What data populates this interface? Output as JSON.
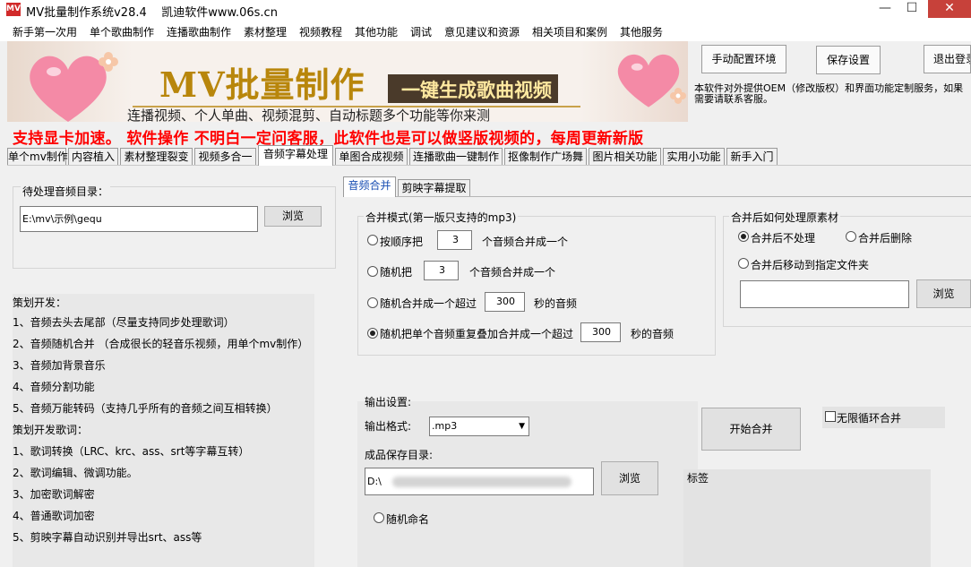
{
  "titlebar": {
    "title": "MV批量制作系统v28.4    凯迪软件www.06s.cn",
    "icon": "mv-app-icon",
    "icon_text": "MV",
    "minimize": "—",
    "maximize": "☐",
    "close": "✕"
  },
  "menu": [
    "新手第一次用",
    "单个歌曲制作",
    "连播歌曲制作",
    "素材整理",
    "视频教程",
    "其他功能",
    "调试",
    "意见建议和资源",
    "相关项目和案例",
    "其他服务"
  ],
  "banner": {
    "title": "MV批量制作",
    "slogan": "一键生成歌曲视频",
    "subtitle": "连播视频、个人单曲、视频混剪、自动标题多个功能等你来测"
  },
  "top_buttons": {
    "configure": "手动配置环境",
    "save": "保存设置",
    "exit": "退出登录"
  },
  "service_text": "本软件对外提供OEM（修改版权）和界面功能定制服务，如果需要请联系客服。",
  "notice": "支持显卡加速。  软件操作  不明白一定问客服，此软件也是可以做竖版视频的，每周更新新版",
  "main_tabs": [
    "单个mv制作",
    "内容植入",
    "素材整理裂变",
    "视频多合一",
    "音频字幕处理",
    "单图合成视频",
    "连播歌曲一键制作",
    "抠像制作广场舞",
    "图片相关功能",
    "实用小功能",
    "新手入门"
  ],
  "main_tab_active": 4,
  "left": {
    "dir_label": "待处理音频目录：",
    "dir_value": "E:\\mv\\示例\\gequ",
    "browse": "浏览",
    "notes": [
      "策划开发：",
      "1、音频去头去尾部（尽量支持同步处理歌词）",
      "2、音频随机合并 （合成很长的轻音乐视频，用单个mv制作）",
      "3、音频加背景音乐",
      "4、音频分割功能",
      "5、音频万能转码（支持几乎所有的音频之间互相转换）",
      "策划开发歌词：",
      "1、歌词转换（LRC、krc、ass、srt等字幕互转）",
      "2、歌词编辑、微调功能。",
      "3、加密歌词解密",
      "4、普通歌词加密",
      "5、剪映字幕自动识别并导出srt、ass等"
    ]
  },
  "sub_tabs": [
    "音频合并",
    "剪映字幕提取"
  ],
  "sub_tab_active": 0,
  "merge_mode": {
    "title": "合并模式(第一版只支持的mp3)",
    "options": [
      {
        "before": "按顺序把",
        "value": "3",
        "after": "个音频合并成一个",
        "selected": false
      },
      {
        "before": "随机把",
        "value": "3",
        "after": "个音频合并成一个",
        "selected": false
      },
      {
        "before": "随机合并成一个超过",
        "value": "300",
        "after": "秒的音频",
        "selected": false
      },
      {
        "before": "随机把单个音频重复叠加合并成一个超过",
        "value": "300",
        "after": "秒的音频",
        "selected": true
      }
    ]
  },
  "source_handling": {
    "title": "合并后如何处理原素材",
    "opt1": "合并后不处理",
    "opt2": "合并后删除",
    "opt3": "合并后移动到指定文件夹",
    "browse": "浏览"
  },
  "output": {
    "title": "输出设置:",
    "format_label": "输出格式:",
    "format_value": ".mp3",
    "save_label": "成品保存目录:",
    "save_value": "D:\\",
    "browse": "浏览",
    "random_name": "随机命名"
  },
  "start_button": "开始合并",
  "loop_label": "无限循环合并",
  "tags_label": "标签"
}
